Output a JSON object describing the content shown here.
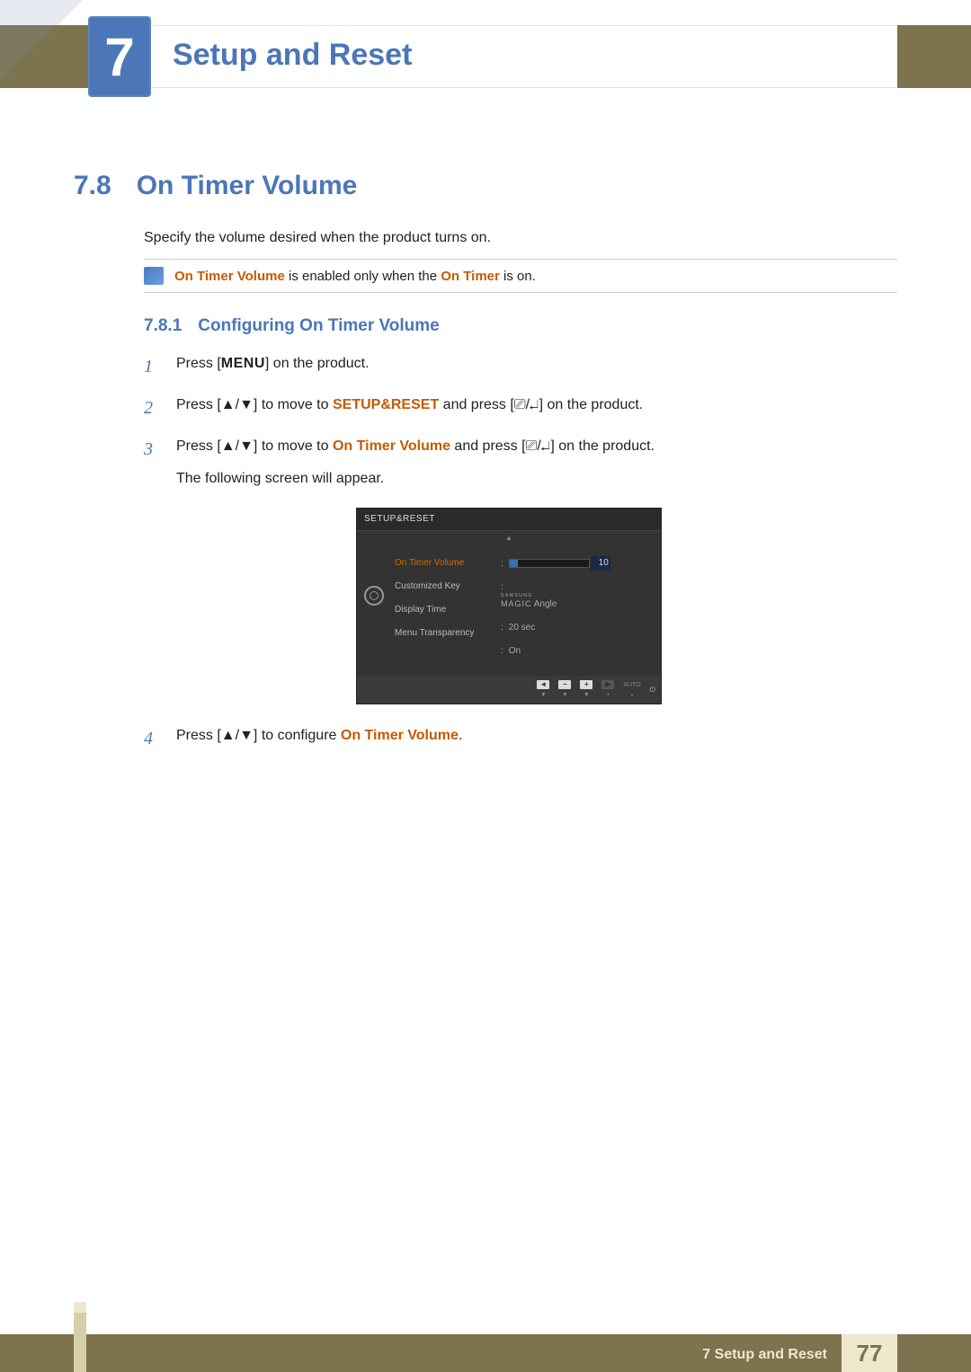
{
  "header": {
    "chapter_number": "7",
    "chapter_title": "Setup and Reset"
  },
  "section": {
    "number": "7.8",
    "title": "On Timer  Volume",
    "intro": "Specify the volume desired when the product turns on."
  },
  "note": {
    "prefix": "On Timer  Volume",
    "mid": " is enabled only when the ",
    "suffix": "On Timer",
    "tail": " is on."
  },
  "subsection": {
    "number": "7.8.1",
    "title": "Configuring On Timer  Volume"
  },
  "steps": [
    {
      "num": "1",
      "a": "Press [",
      "menu": "MENU",
      "b": "] on the product."
    },
    {
      "num": "2",
      "a": "Press [",
      "arrows": "▲/▼",
      "b": "] to move to ",
      "target": "SETUP&RESET",
      "c": " and press [",
      "enter_glyph": "⎚/↵",
      "d": "] on the product."
    },
    {
      "num": "3",
      "a": "Press [",
      "arrows": "▲/▼",
      "b": "] to move to ",
      "target": "On Timer  Volume",
      "c": " and press [",
      "enter_glyph": "⎚/↵",
      "d": "] on the product.",
      "follow": "The following screen will appear."
    },
    {
      "num": "4",
      "a": "Press [",
      "arrows": "▲/▼",
      "b": "] to configure ",
      "target": "On Timer  Volume",
      "c": "."
    }
  ],
  "osd": {
    "title": "SETUP&RESET",
    "up": "▲",
    "rows": [
      {
        "label": "On Timer  Volume",
        "value_type": "slider",
        "value": "10",
        "fill_pct": 10,
        "active": true
      },
      {
        "label": "Customized Key",
        "value_type": "magic",
        "magic_top": "SAMSUNG",
        "magic_main": "MAGIC",
        "value": "Angle"
      },
      {
        "label": "Display Time",
        "value_type": "text",
        "value": "20 sec"
      },
      {
        "label": "Menu Transparency",
        "value_type": "text",
        "value": "On"
      }
    ],
    "footer": {
      "items": [
        {
          "icon": "◄",
          "sub": "▼"
        },
        {
          "icon": "−",
          "sub": "▼"
        },
        {
          "icon": "+",
          "sub": "▼"
        },
        {
          "icon": "▶",
          "sub": "•",
          "dark": true
        },
        {
          "text": "AUTO",
          "sub": "•"
        },
        {
          "icon": "⏻",
          "sub": ""
        }
      ]
    }
  },
  "footer": {
    "chapter_ref": "7 Setup and Reset",
    "page": "77"
  }
}
